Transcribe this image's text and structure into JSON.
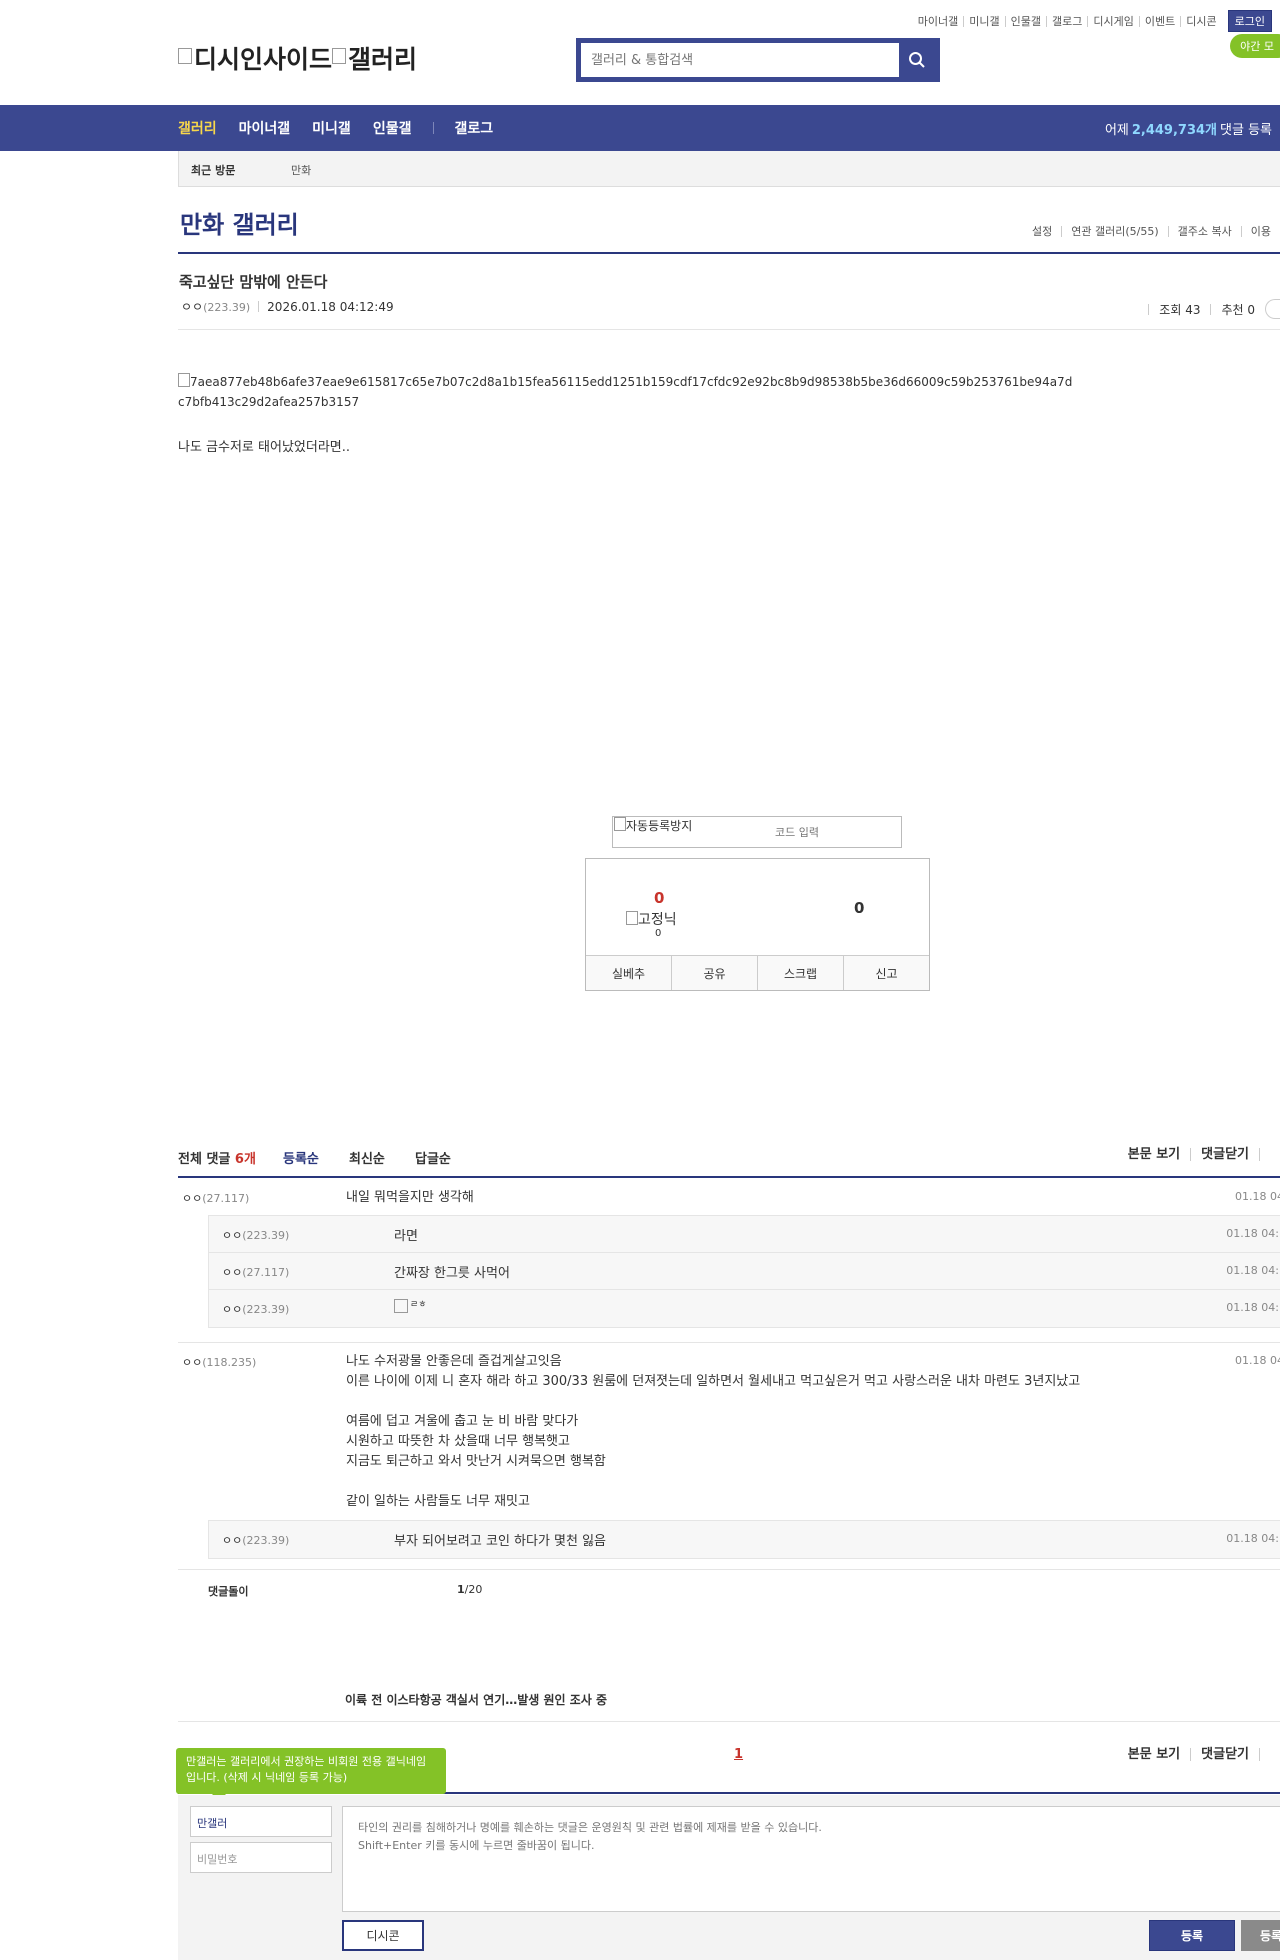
{
  "util_links": [
    "마이너갤",
    "미니갤",
    "인물갤",
    "갤로그",
    "디시게임",
    "이벤트",
    "디시콘"
  ],
  "login_label": "로그인",
  "night_label": "야간 모",
  "logo": {
    "left_alt": "디시인사이드",
    "right_alt": "갤러리"
  },
  "search": {
    "placeholder": "갤러리 & 통합검색"
  },
  "gnb": {
    "items": [
      "갤러리",
      "마이너갤",
      "미니갤",
      "인물갤"
    ],
    "gallog": "갤로그",
    "stat_prefix": "어제",
    "stat_value": "2,449,734개",
    "stat_suffix": "댓글 등록"
  },
  "recent": {
    "title": "최근 방문",
    "item": "만화"
  },
  "gallery": {
    "title": "만화 갤러리",
    "menu": [
      "설정",
      "연관 갤러리(5/55)",
      "갤주소 복사",
      "이용"
    ]
  },
  "post": {
    "title": "죽고싶단 맘밖에 안든다",
    "nick": "ㅇㅇ",
    "ip": "(223.39)",
    "date": "2026.01.18 04:12:49",
    "views_label": "조회 43",
    "recommend_label": "추천 0",
    "image_alt": "7aea877eb48b6afe37eae9e615817c65e7b07c2d8a1b15fea56115edd1251b159cdf17cfdc92e92bc8b9d98538b5be36d66009c59b253761be94a7dc7bfb413c29d2afea257b3157",
    "body": "나도 금수저로 태어났었더라면.."
  },
  "captcha": {
    "img_alt": "자동등록방지",
    "placeholder": "코드 입력"
  },
  "recommend": {
    "up": "0",
    "gonic_label": "고정닉",
    "gonic_count": "0",
    "down": "0",
    "buttons": [
      "실베추",
      "공유",
      "스크랩",
      "신고"
    ]
  },
  "comments_header": {
    "label": "전체 댓글",
    "count": "6개",
    "sorts": [
      "등록순",
      "최신순",
      "답글순"
    ],
    "right": [
      "본문 보기",
      "댓글닫기"
    ]
  },
  "comments": [
    {
      "nick": "ㅇㅇ",
      "ip": "(27.117)",
      "text": "내일 뭐먹을지만 생각해",
      "date": "01.18 04"
    },
    {
      "nick": "ㅇㅇ",
      "ip": "(223.39)",
      "text": "라면",
      "date": "01.18 04:1"
    },
    {
      "nick": "ㅇㅇ",
      "ip": "(27.117)",
      "text": "간짜장 한그릇 사먹어",
      "date": "01.18 04:1"
    },
    {
      "nick": "ㅇㅇ",
      "ip": "(223.39)",
      "text": "ㄹㅎ",
      "date": "01.18 04:1"
    },
    {
      "nick": "ㅇㅇ",
      "ip": "(118.235)",
      "text": "나도 수저광물 안좋은데 즐겁게살고잇음\n이른 나이에 이제 니 혼자 해라 하고 300/33 원룸에 던져졋는데 일하면서 월세내고 먹고싶은거 먹고 사랑스러운 내차 마련도 3년지났고\n\n여름에 덥고 겨울에 춥고 눈 비 바람 맞다가\n시원하고 따뜻한 차 샀을때 너무 행복햇고\n지금도 퇴근하고 와서 맛난거 시켜묵으면 행복함\n\n같이 일하는 사람들도 너무 재밋고",
      "date": "01.18 04"
    },
    {
      "nick": "ㅇㅇ",
      "ip": "(223.39)",
      "text": "부자 되어보려고 코인 하다가 몇천 잃음",
      "date": "01.18 04:1"
    }
  ],
  "dolgi": {
    "label": "댓글돌이",
    "page_current": "1",
    "page_total": "/20"
  },
  "news_headline": "이륙 전 이스타항공 객실서 연기…발생 원인 조사 중",
  "pager_current": "1",
  "footer_right": [
    "본문 보기",
    "댓글닫기"
  ],
  "write": {
    "tip": "만갤러는 갤러리에서 권장하는 비회원 전용 갤닉네임입니다. (삭제 시 닉네임 등록 가능)",
    "nick_value": "만갤러",
    "password_placeholder": "비밀번호",
    "textarea_placeholder": "타인의 권리를 침해하거나 명예를 훼손하는 댓글은 운영원칙 및 관련 법률에 제재를 받을 수 있습니다.\nShift+Enter 키를 동시에 누르면 줄바꿈이 됩니다.",
    "dccon_label": "디시콘",
    "submit_label": "등록",
    "submit2_label": "등록"
  },
  "colors": {
    "brand": "#3b4890",
    "brand_dark": "#29367c",
    "accent_red": "#c8342c",
    "night_green": "#84c227"
  }
}
